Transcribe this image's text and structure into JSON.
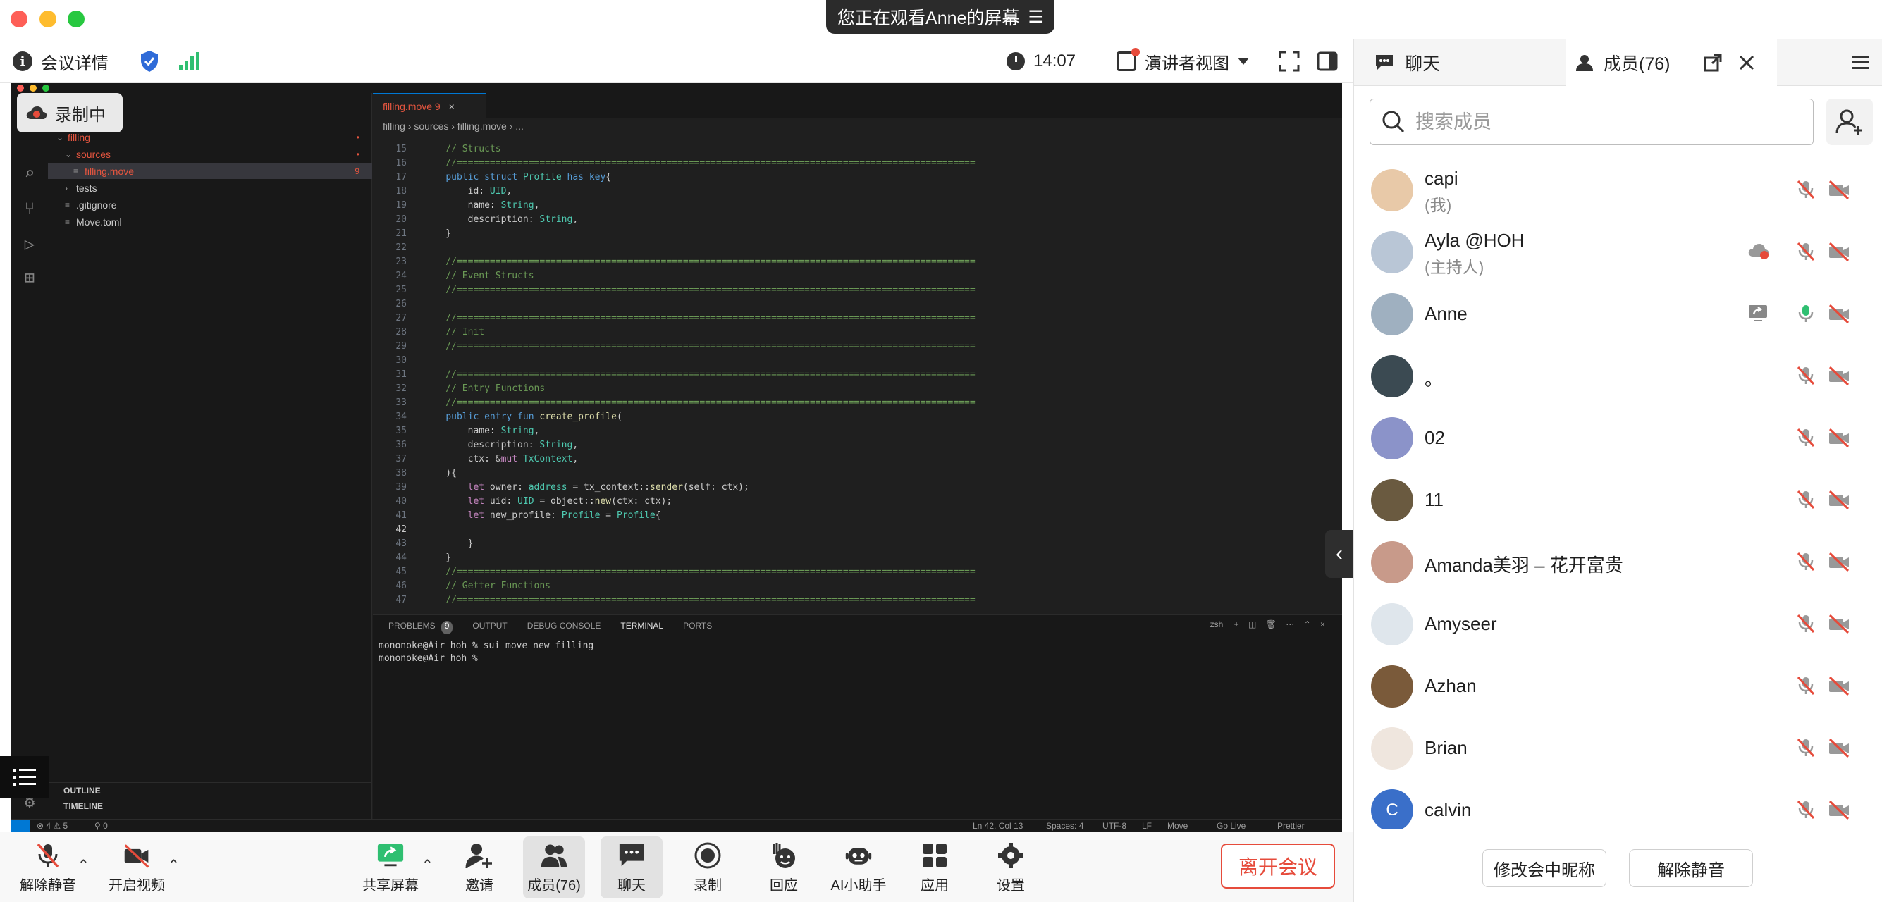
{
  "screen_banner": {
    "text": "您正在观看Anne的屏幕",
    "menu_icon": "menu-icon"
  },
  "top_bar": {
    "meeting_details": "会议详情",
    "time": "14:07",
    "presenter_view": "演讲者视图"
  },
  "recording_badge": "录制中",
  "shared_screen": {
    "explorer": [
      {
        "label": "filling",
        "depth": 0,
        "kind": "folder-open",
        "badge": "•"
      },
      {
        "label": "sources",
        "depth": 1,
        "kind": "folder-open",
        "badge": "•"
      },
      {
        "label": "filling.move",
        "depth": 2,
        "kind": "file",
        "badge": "9"
      },
      {
        "label": "tests",
        "depth": 1,
        "kind": "folder",
        "badge": ""
      },
      {
        "label": ".gitignore",
        "depth": 1,
        "kind": "file",
        "badge": ""
      },
      {
        "label": "Move.toml",
        "depth": 1,
        "kind": "file",
        "badge": ""
      }
    ],
    "outline_label": "OUTLINE",
    "timeline_label": "TIMELINE",
    "editor_tab": "filling.move 9",
    "breadcrumb": "filling  ›  sources  ›  filling.move  ›  ...",
    "code_lines": [
      {
        "n": "15",
        "text": "    // Structs"
      },
      {
        "n": "16",
        "text": "    //=============================================================================================="
      },
      {
        "n": "17",
        "text": "    public struct Profile has key{"
      },
      {
        "n": "18",
        "text": "        id: UID,"
      },
      {
        "n": "19",
        "text": "        name: String,"
      },
      {
        "n": "20",
        "text": "        description: String,"
      },
      {
        "n": "21",
        "text": "    }"
      },
      {
        "n": "22",
        "text": ""
      },
      {
        "n": "23",
        "text": "    //=============================================================================================="
      },
      {
        "n": "24",
        "text": "    // Event Structs"
      },
      {
        "n": "25",
        "text": "    //=============================================================================================="
      },
      {
        "n": "26",
        "text": ""
      },
      {
        "n": "27",
        "text": "    //=============================================================================================="
      },
      {
        "n": "28",
        "text": "    // Init"
      },
      {
        "n": "29",
        "text": "    //=============================================================================================="
      },
      {
        "n": "30",
        "text": ""
      },
      {
        "n": "31",
        "text": "    //=============================================================================================="
      },
      {
        "n": "32",
        "text": "    // Entry Functions"
      },
      {
        "n": "33",
        "text": "    //=============================================================================================="
      },
      {
        "n": "34",
        "text": "    public entry fun create_profile("
      },
      {
        "n": "35",
        "text": "        name: String,"
      },
      {
        "n": "36",
        "text": "        description: String,"
      },
      {
        "n": "37",
        "text": "        ctx: &mut TxContext,"
      },
      {
        "n": "38",
        "text": "    ){"
      },
      {
        "n": "39",
        "text": "        let owner: address = tx_context::sender(self: ctx);"
      },
      {
        "n": "40",
        "text": "        let uid: UID = object::new(ctx: ctx);"
      },
      {
        "n": "41",
        "text": "        let new_profile: Profile = Profile{"
      },
      {
        "n": "42",
        "text": ""
      },
      {
        "n": "43",
        "text": "        }"
      },
      {
        "n": "44",
        "text": "    }"
      },
      {
        "n": "45",
        "text": "    //=============================================================================================="
      },
      {
        "n": "46",
        "text": "    // Getter Functions"
      },
      {
        "n": "47",
        "text": "    //=============================================================================================="
      }
    ],
    "panel_tabs": [
      "PROBLEMS",
      "OUTPUT",
      "DEBUG CONSOLE",
      "TERMINAL",
      "PORTS"
    ],
    "problems_count": "9",
    "terminal_shell": "zsh",
    "terminal_lines": [
      "mononoke@Air hoh % sui move new filling",
      "mononoke@Air hoh % "
    ],
    "status": {
      "errors": "⊗ 4 ⚠ 5",
      "ports": "⚲ 0",
      "position": "Ln 42, Col 13",
      "spaces": "Spaces: 4",
      "encoding": "UTF-8",
      "eol": "LF",
      "language": "Move",
      "golive": "Go Live",
      "prettier": "Prettier"
    }
  },
  "right_panel": {
    "chat_tab": "聊天",
    "members_tab": "成员(76)",
    "search_placeholder": "搜索成员",
    "members": [
      {
        "name": "capi",
        "sub": "(我)",
        "avatar_color": "#e8c9a8",
        "mic": "muted",
        "cam": "off"
      },
      {
        "name": "Ayla @HOH",
        "sub": "(主持人)",
        "avatar_color": "#b9c6d6",
        "mic": "muted",
        "cam": "off",
        "recording": true
      },
      {
        "name": "Anne",
        "sub": "",
        "avatar_color": "#9fb0c0",
        "mic": "on",
        "cam": "off",
        "sharing": true
      },
      {
        "name": "。",
        "sub": "",
        "avatar_color": "#3b4a52",
        "mic": "muted",
        "cam": "off"
      },
      {
        "name": "02",
        "sub": "",
        "avatar_color": "#8b93c9",
        "mic": "muted",
        "cam": "off"
      },
      {
        "name": "11",
        "sub": "",
        "avatar_color": "#6a5a40",
        "mic": "muted",
        "cam": "off"
      },
      {
        "name": "Amanda美羽 – 花开富贵",
        "sub": "",
        "avatar_color": "#c89a8a",
        "mic": "muted",
        "cam": "off"
      },
      {
        "name": "Amyseer",
        "sub": "",
        "avatar_color": "#dfe6ec",
        "mic": "muted",
        "cam": "off"
      },
      {
        "name": "Azhan",
        "sub": "",
        "avatar_color": "#7a5a3a",
        "mic": "muted",
        "cam": "off"
      },
      {
        "name": "Brian",
        "sub": "",
        "avatar_color": "#efe6de",
        "mic": "muted",
        "cam": "off"
      },
      {
        "name": "calvin",
        "sub": "",
        "avatar_color": "#3a6fc9",
        "avatar_letter": "C",
        "mic": "muted",
        "cam": "off"
      }
    ],
    "rename_button": "修改会中昵称",
    "unmute_button": "解除静音"
  },
  "toolbar": {
    "unmute": "解除静音",
    "start_video": "开启视频",
    "share_screen": "共享屏幕",
    "invite": "邀请",
    "members": "成员(76)",
    "chat": "聊天",
    "record": "录制",
    "react": "回应",
    "ai_assistant": "AI小助手",
    "apps": "应用",
    "settings": "设置",
    "leave": "离开会议"
  },
  "colors": {
    "accent_red": "#e64b3b",
    "vscode_bg": "#1f1f1f",
    "share_green": "#2fbf71",
    "security_blue": "#2f6bd8"
  }
}
